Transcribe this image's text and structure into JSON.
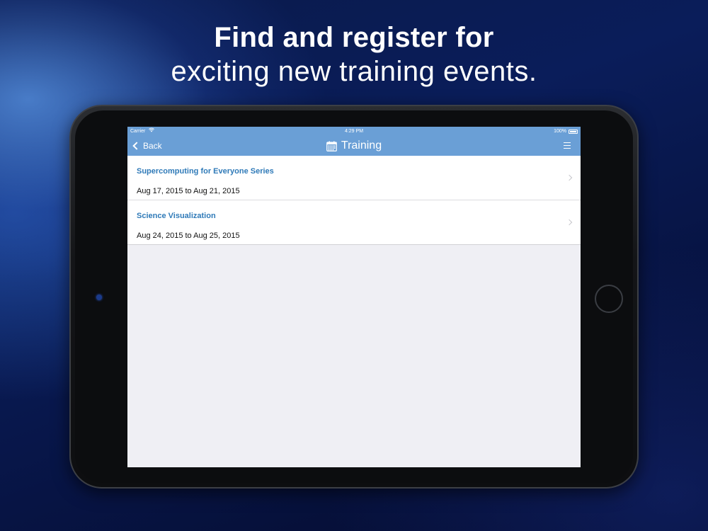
{
  "headline": {
    "line1": "Find and register for",
    "line2": "exciting new training events."
  },
  "statusbar": {
    "carrier": "Carrier",
    "time": "4:29 PM",
    "battery": "100%"
  },
  "navbar": {
    "back_label": "Back",
    "title": "Training",
    "title_icon": "calendar-icon",
    "menu_icon": "hamburger-menu-icon"
  },
  "events": [
    {
      "title": "Supercomputing for Everyone Series",
      "dates": "Aug 17, 2015 to Aug 21, 2015"
    },
    {
      "title": "Science Visualization",
      "dates": "Aug 24, 2015 to Aug 25, 2015"
    }
  ],
  "colors": {
    "nav_blue": "#6a9fd6",
    "link_blue": "#2f7ab8",
    "screen_bg": "#efeff4"
  }
}
